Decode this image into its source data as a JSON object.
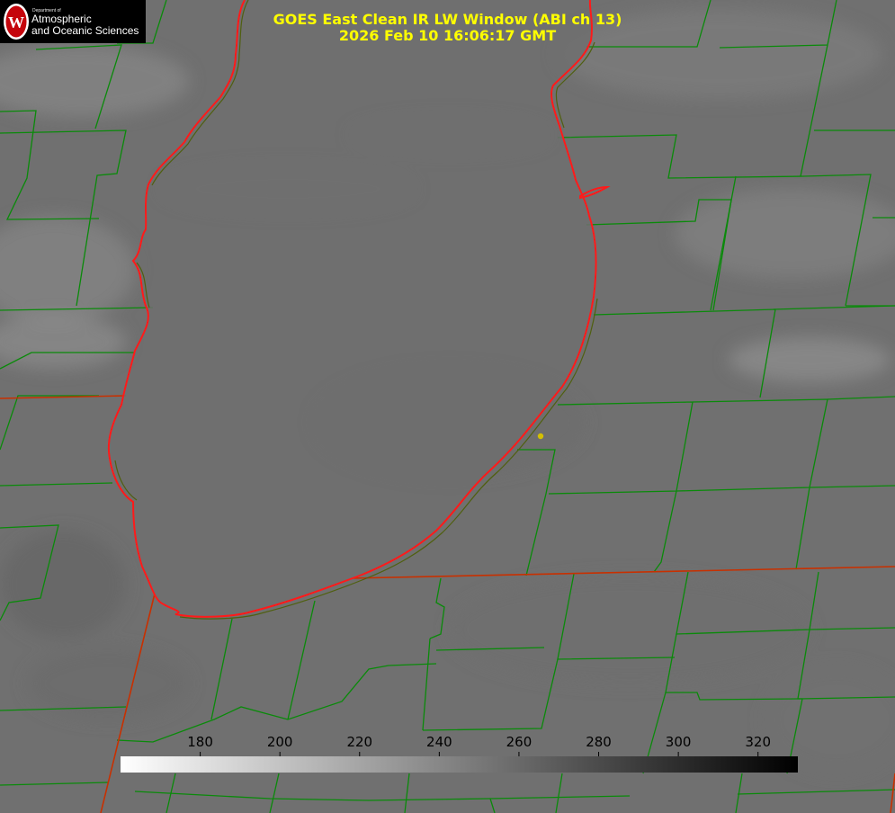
{
  "header": {
    "title_line1": "GOES East Clean IR LW Window (ABI ch 13)",
    "title_line2": "2026 Feb 10 16:06:17 GMT",
    "title_color": "#ffff00"
  },
  "logo": {
    "department": "Department of",
    "line1": "Atmospheric",
    "line2": "and Oceanic Sciences",
    "seal_letter": "W",
    "seal_color": "#c5050c"
  },
  "colors": {
    "county_borders": "#0a8a0a",
    "state_borders": "#c83000",
    "lake_shoreline": "#ff1a1a",
    "location_marker": "#d4c000",
    "background_gray": "#707070"
  },
  "colorbar": {
    "min": 160,
    "max": 330,
    "ticks": [
      180,
      200,
      220,
      240,
      260,
      280,
      300,
      320
    ],
    "gradient": "white-to-black"
  }
}
